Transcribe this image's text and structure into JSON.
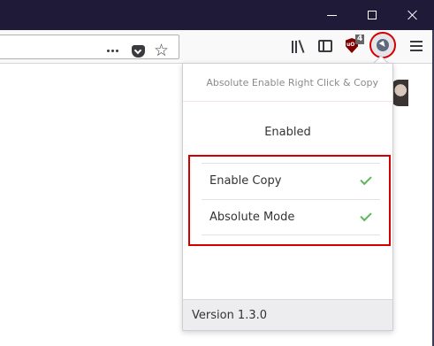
{
  "extension": {
    "title": "Absolute Enable Right Click & Copy",
    "status": "Enabled",
    "options": [
      {
        "label": "Enable Copy",
        "checked": true
      },
      {
        "label": "Absolute Mode",
        "checked": true
      }
    ],
    "version": "Version 1.3.0"
  },
  "toolbar": {
    "ublock_badge": "4",
    "icons": [
      "page-actions-icon",
      "pocket-icon",
      "bookmark-star-icon",
      "library-icon",
      "sidebar-icon",
      "ublock-icon",
      "extension-icon",
      "menu-icon"
    ]
  },
  "colors": {
    "titlebar": "#1f1a38",
    "highlight": "#d40000",
    "check": "#5cb85c"
  }
}
